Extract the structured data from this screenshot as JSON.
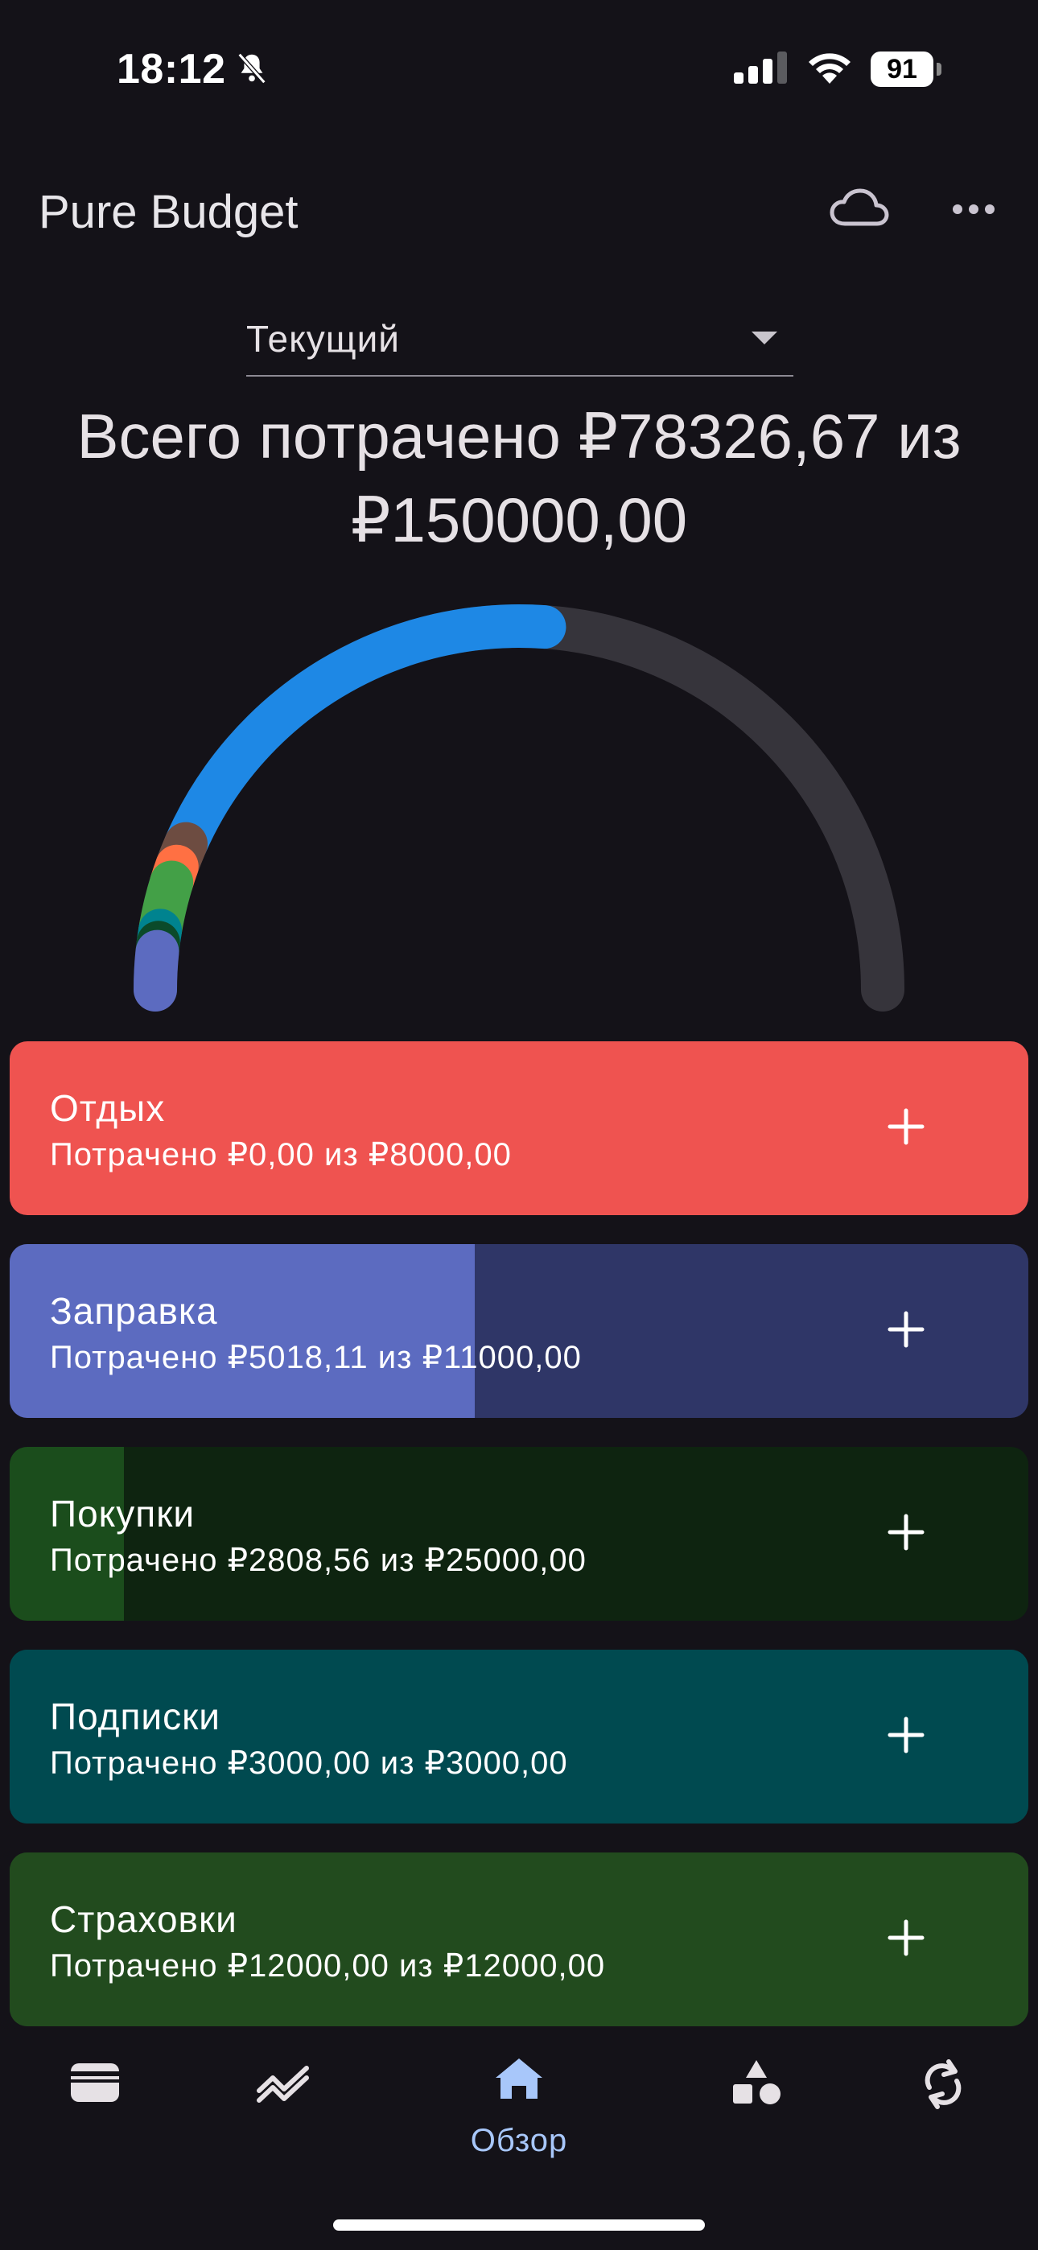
{
  "status_bar": {
    "time": "18:12",
    "battery": "91"
  },
  "app": {
    "title": "Pure Budget"
  },
  "period_selector": {
    "value": "Текущий"
  },
  "summary": {
    "line1": "Всего потрачено ₽78326,67 из",
    "line2": "₽150000,00",
    "spent": 78326.67,
    "total": 150000.0
  },
  "gauge": {
    "track_color": "#36343b",
    "segments": [
      {
        "value": 5018.11,
        "color": "#5c6bc0"
      },
      {
        "value": 1200,
        "color": "#0b4a2a"
      },
      {
        "value": 1600,
        "color": "#00838f"
      },
      {
        "value": 6500,
        "color": "#43a047"
      },
      {
        "value": 2200,
        "color": "#ff7043"
      },
      {
        "value": 3200,
        "color": "#6d4c41"
      },
      {
        "value": 58608.56,
        "color": "#1e88e5"
      }
    ]
  },
  "categories": [
    {
      "name": "Отдых",
      "spent_text": "Потрачено ₽0,00 из ₽8000,00",
      "spent": 0.0,
      "budget": 8000.0,
      "color": "#ef5350",
      "dark": "#ef5350"
    },
    {
      "name": "Заправка",
      "spent_text": "Потрачено ₽5018,11 из ₽11000,00",
      "spent": 5018.11,
      "budget": 11000.0,
      "color": "#5c6bc0",
      "dark": "#2f3667"
    },
    {
      "name": "Покупки",
      "spent_text": "Потрачено ₽2808,56 из ₽25000,00",
      "spent": 2808.56,
      "budget": 25000.0,
      "color": "#1b4d1c",
      "dark": "#0e2410"
    },
    {
      "name": "Подписки",
      "spent_text": "Потрачено ₽3000,00 из ₽3000,00",
      "spent": 3000.0,
      "budget": 3000.0,
      "color": "#004a50",
      "dark": "#004a50"
    },
    {
      "name": "Страховки",
      "spent_text": "Потрачено ₽12000,00 из ₽12000,00",
      "spent": 12000.0,
      "budget": 12000.0,
      "color": "#224b1e",
      "dark": "#224b1e"
    }
  ],
  "nav": {
    "items": [
      {
        "icon": "wallet-icon"
      },
      {
        "icon": "trend-icon"
      },
      {
        "icon": "home-icon",
        "label": "Обзор",
        "active": true
      },
      {
        "icon": "shapes-icon"
      },
      {
        "icon": "sync-icon"
      }
    ]
  },
  "icons": {
    "cloud": "cloud-icon",
    "more": "more-icon",
    "plus": "plus-icon",
    "bell_off": "bell-off-icon"
  }
}
